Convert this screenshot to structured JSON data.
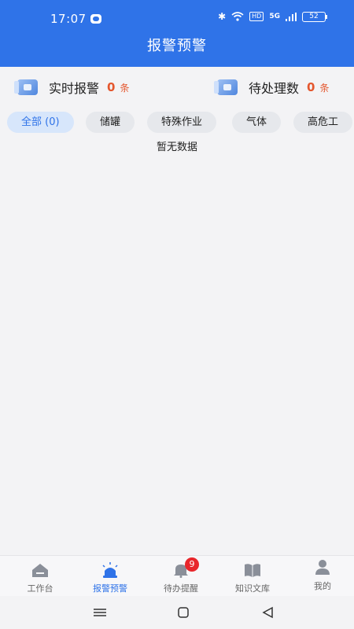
{
  "status_bar": {
    "time": "17:07",
    "network": "5G",
    "hd": "HD",
    "battery": "52"
  },
  "header": {
    "title": "报警预警"
  },
  "stats": [
    {
      "label": "实时报警",
      "count": "0",
      "unit": "条",
      "icon": "alarm-card-icon"
    },
    {
      "label": "待处理数",
      "count": "0",
      "unit": "条",
      "icon": "pending-card-icon"
    }
  ],
  "tabs": [
    {
      "label": "全部 (0)",
      "active": true
    },
    {
      "label": "储罐"
    },
    {
      "label": "特殊作业"
    },
    {
      "label": "气体"
    },
    {
      "label": "高危工"
    }
  ],
  "empty_text": "暂无数据",
  "bottom_nav": [
    {
      "label": "工作台",
      "icon": "home-icon"
    },
    {
      "label": "报警预警",
      "icon": "siren-icon",
      "active": true
    },
    {
      "label": "待办提醒",
      "icon": "bell-icon",
      "badge": "9"
    },
    {
      "label": "知识文库",
      "icon": "book-icon"
    },
    {
      "label": "我的",
      "icon": "user-icon"
    }
  ],
  "colors": {
    "primary": "#2f73e8",
    "count": "#e4572e",
    "badge": "#e8262b"
  }
}
